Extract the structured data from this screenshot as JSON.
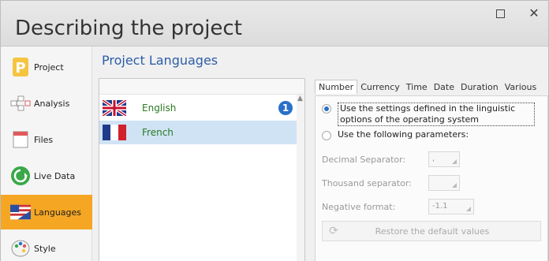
{
  "window": {
    "title": "Describing the project",
    "maximize_icon": "maximize-icon",
    "close_glyph": "✕"
  },
  "sidebar": {
    "items": [
      {
        "label": "Project",
        "icon": "project-p-icon"
      },
      {
        "label": "Analysis",
        "icon": "analysis-diagram-icon"
      },
      {
        "label": "Files",
        "icon": "files-icon"
      },
      {
        "label": "Live Data",
        "icon": "live-data-icon"
      },
      {
        "label": "Languages",
        "icon": "languages-flag-icon",
        "active": true
      },
      {
        "label": "Style",
        "icon": "palette-icon"
      }
    ]
  },
  "main": {
    "section_title": "Project Languages",
    "languages": [
      {
        "name": "English",
        "flag": "uk-flag-icon",
        "badge": "1"
      },
      {
        "name": "French",
        "flag": "france-flag-icon",
        "selected": true
      }
    ],
    "tabs": [
      "Number",
      "Currency",
      "Time",
      "Date",
      "Duration",
      "Various"
    ],
    "active_tab": "Number",
    "number": {
      "option1": "Use the settings defined in the linguistic options of the operating system",
      "option2": "Use the following parameters:",
      "decimal_label": "Decimal Separator:",
      "decimal_value": ",",
      "thousand_label": "Thousand separator:",
      "thousand_value": "",
      "negative_label": "Negative format:",
      "negative_value": "-1.1",
      "restore_label": "Restore the default values"
    }
  },
  "colors": {
    "accent_orange": "#f5a623",
    "title_blue": "#2d5da8",
    "language_green": "#2a7a22",
    "selection_blue": "#cfe3f5"
  }
}
